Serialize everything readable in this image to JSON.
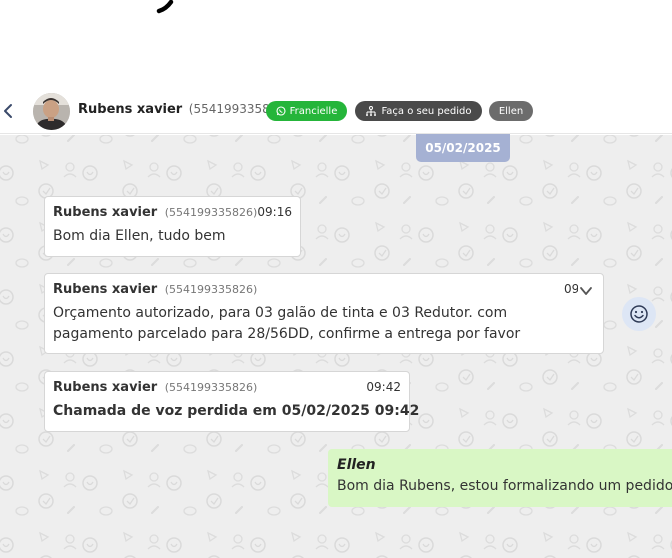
{
  "header": {
    "contact_name": "Rubens xavier",
    "contact_phone": "(554199335826)",
    "chips": {
      "attendant": "Francielle",
      "order": "Faça o seu pedido",
      "user": "Ellen"
    }
  },
  "date_separator": "05/02/2025",
  "messages": [
    {
      "sender": "Rubens xavier",
      "phone": "(554199335826)",
      "time": "09:16",
      "lines": [
        "Bom dia Ellen, tudo bem"
      ]
    },
    {
      "sender": "Rubens xavier",
      "phone": "(554199335826)",
      "time": "09",
      "lines": [
        "Orçamento autorizado, para 03 galão de tinta e 03 Redutor. com",
        "pagamento parcelado para 28/56DD, confirme a entrega por favor"
      ]
    },
    {
      "sender": "Rubens xavier",
      "phone": "(554199335826)",
      "time": "09:42",
      "lines": [
        "Chamada de voz perdida em 05/02/2025 09:42"
      ]
    }
  ],
  "outgoing": {
    "sender": "Ellen",
    "text": "Bom dia Rubens, estou formalizando um pedido"
  },
  "colors": {
    "attendant_chip": "#25b53a",
    "order_chip": "#4a4a4a",
    "user_chip": "#6c6c6c",
    "date_pill": "#a5b1d3",
    "outgoing_bubble": "#d9f7c5",
    "chat_background": "#eeeeee"
  },
  "icons": {
    "back": "chevron-left-icon",
    "whatsapp": "whatsapp-icon",
    "order": "network-icon",
    "message_menu": "chevron-down-icon",
    "emoji": "smiley-icon"
  }
}
